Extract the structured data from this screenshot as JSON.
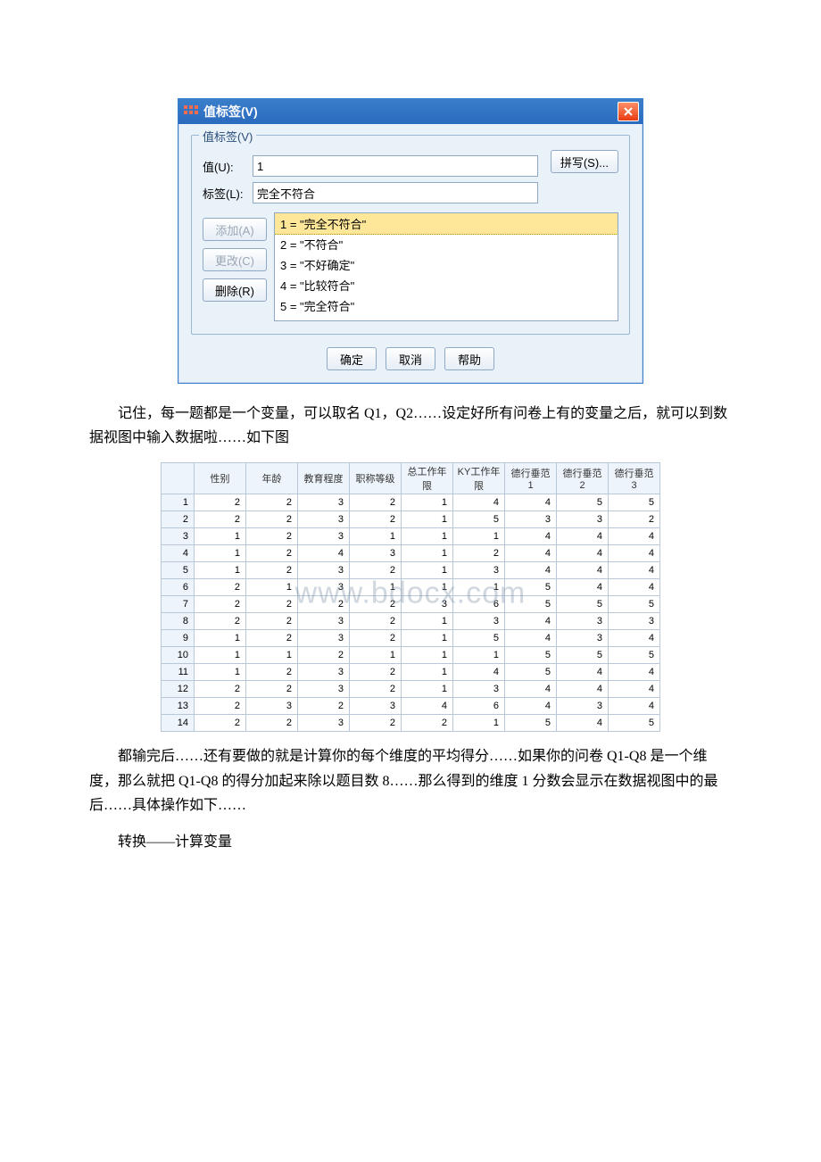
{
  "dialog": {
    "title": "值标签(V)",
    "fieldset_label": "值标签(V)",
    "value_label": "值(U):",
    "value_input": "1",
    "label_label": "标签(L):",
    "label_input": "完全不符合",
    "spell_btn": "拼写(S)...",
    "add_btn": "添加(A)",
    "change_btn": "更改(C)",
    "remove_btn": "删除(R)",
    "list": [
      "1 = \"完全不符合\"",
      "2 = \"不符合\"",
      "3 = \"不好确定\"",
      "4 = \"比较符合\"",
      "5 = \"完全符合\""
    ],
    "ok": "确定",
    "cancel": "取消",
    "help": "帮助"
  },
  "para1": "记住，每一题都是一个变量，可以取名 Q1，Q2……设定好所有问卷上有的变量之后，就可以到数据视图中输入数据啦……如下图",
  "para2": "都输完后……还有要做的就是计算你的每个维度的平均得分……如果你的问卷 Q1-Q8 是一个维度，那么就把 Q1-Q8 的得分加起来除以题目数 8……那么得到的维度 1 分数会显示在数据视图中的最后……具体操作如下……",
  "para3": "转换——计算变量",
  "watermark": "www.bdocx.com",
  "chart_data": {
    "type": "table",
    "columns": [
      "性别",
      "年龄",
      "教育程度",
      "职称等级",
      "总工作年限",
      "KY工作年限",
      "德行垂范1",
      "德行垂范2",
      "德行垂范3"
    ],
    "rows": [
      [
        2,
        2,
        3,
        2,
        1,
        4,
        4,
        5,
        5
      ],
      [
        2,
        2,
        3,
        2,
        1,
        5,
        3,
        3,
        2
      ],
      [
        1,
        2,
        3,
        1,
        1,
        1,
        4,
        4,
        4
      ],
      [
        1,
        2,
        4,
        3,
        1,
        2,
        4,
        4,
        4
      ],
      [
        1,
        2,
        3,
        2,
        1,
        3,
        4,
        4,
        4
      ],
      [
        2,
        1,
        3,
        1,
        1,
        1,
        5,
        4,
        4
      ],
      [
        2,
        2,
        2,
        2,
        3,
        6,
        5,
        5,
        5
      ],
      [
        2,
        2,
        3,
        2,
        1,
        3,
        4,
        3,
        3
      ],
      [
        1,
        2,
        3,
        2,
        1,
        5,
        4,
        3,
        4
      ],
      [
        1,
        1,
        2,
        1,
        1,
        1,
        5,
        5,
        5
      ],
      [
        1,
        2,
        3,
        2,
        1,
        4,
        5,
        4,
        4
      ],
      [
        2,
        2,
        3,
        2,
        1,
        3,
        4,
        4,
        4
      ],
      [
        2,
        3,
        2,
        3,
        4,
        6,
        4,
        3,
        4
      ],
      [
        2,
        2,
        3,
        2,
        2,
        1,
        5,
        4,
        5
      ]
    ]
  }
}
